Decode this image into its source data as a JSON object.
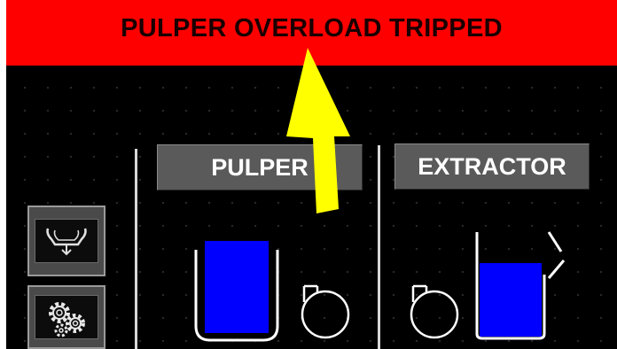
{
  "alarm": {
    "message": "PULPER OVERLOAD TRIPPED",
    "color": "#ff0000"
  },
  "sections": [
    {
      "label": "PULPER"
    },
    {
      "label": "EXTRACTOR"
    }
  ],
  "side_buttons": [
    {
      "icon": "discharge-tank-icon"
    },
    {
      "icon": "gears-icon"
    }
  ],
  "tanks": {
    "pulper_fill_color": "#0000ff",
    "extractor_fill_color": "#0000ff"
  },
  "annotation": {
    "arrow_color": "#ffff00"
  }
}
